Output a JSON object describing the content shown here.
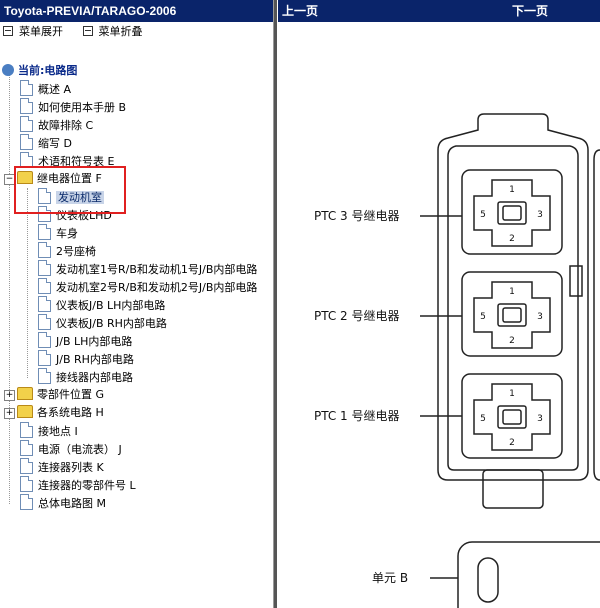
{
  "left_panel": {
    "title": "Toyota-PREVIA/TARAGO-2006",
    "menu": {
      "expand": "菜单展开",
      "collapse": "菜单折叠"
    },
    "root": "当前:电路图",
    "items": [
      "概述 A",
      "如何使用本手册 B",
      "故障排除 C",
      "缩写 D",
      "术语和符号表 E",
      "继电器位置 F",
      "发动机室",
      "仪表板LHD",
      "车身",
      "2号座椅",
      "发动机室1号R/B和发动机1号J/B内部电路",
      "发动机室2号R/B和发动机2号J/B内部电路",
      "仪表板J/B LH内部电路",
      "仪表板J/B RH内部电路",
      "J/B LH内部电路",
      "J/B RH内部电路",
      "接线器内部电路",
      "零部件位置 G",
      "各系统电路 H",
      "接地点 I",
      "电源（电流表） J",
      "连接器列表 K",
      "连接器的零部件号 L",
      "总体电路图 M"
    ],
    "expander_open": "−",
    "expander_closed": "+"
  },
  "right_panel": {
    "prev": "上一页",
    "next": "下一页",
    "labels": {
      "ptc3": "PTC 3 号继电器",
      "ptc2": "PTC 2 号继电器",
      "ptc1": "PTC 1 号继电器",
      "unit_b": "单元 B"
    },
    "pins": {
      "p1": "1",
      "p2": "2",
      "p3": "3",
      "p5": "5"
    }
  },
  "colors": {
    "title_bar": "#0a246a",
    "highlight_box": "#e02020",
    "selected_bg": "#c8d4e8"
  }
}
